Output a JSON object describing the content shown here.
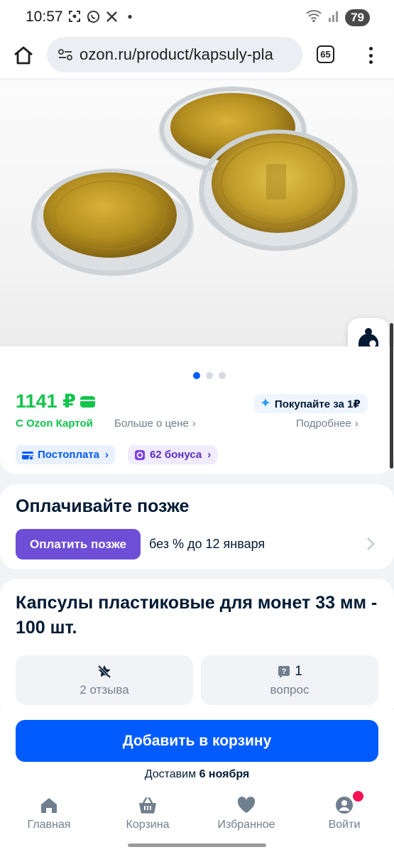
{
  "status_bar": {
    "time": "10:57",
    "battery": "79"
  },
  "browser": {
    "url": "ozon.ru/product/kapsuly-pla",
    "tab_count": "65"
  },
  "gallery": {
    "slide_count": 3,
    "active_slide": 1
  },
  "price_block": {
    "price": "1141 ₽",
    "with_card": "С Ozon Картой",
    "more_about_price": "Больше о цене",
    "buy_for": "Покупайте за 1₽",
    "details": "Подробнее",
    "postpay": "Постоплата",
    "bonus": "62 бонуса"
  },
  "pay_later": {
    "title": "Оплачивайте позже",
    "button": "Оплатить позже",
    "note": "без % до 12 января"
  },
  "product": {
    "title": "Капсулы пластиковые для монет 33 мм - 100 шт.",
    "reviews_label": "2 отзыва",
    "questions_count": "1",
    "questions_label": "вопрос"
  },
  "actions": {
    "add_to_cart": "Добавить в корзину",
    "delivery_prefix": "Доставим",
    "delivery_date": "6 ноября"
  },
  "nav": {
    "home": "Главная",
    "cart": "Корзина",
    "favorites": "Избранное",
    "login": "Войти"
  },
  "colors": {
    "brand_blue": "#005bff",
    "price_green": "#10c44c",
    "pay_later_purple": "#6e4ed6",
    "notification": "#f91155"
  }
}
